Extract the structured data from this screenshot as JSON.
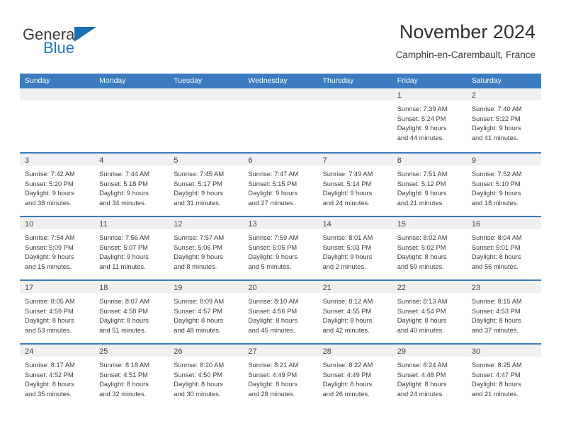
{
  "brand": {
    "name_part1": "General",
    "name_part2": "Blue",
    "flag_icon": "triangle-flag-icon",
    "accent_color": "#1b6fb5"
  },
  "header": {
    "title": "November 2024",
    "subtitle": "Camphin-en-Carembault, France"
  },
  "theme": {
    "header_blue": "#3a7cbf",
    "day_band_gray": "#f0f0f0"
  },
  "calendar": {
    "day_headers": [
      "Sunday",
      "Monday",
      "Tuesday",
      "Wednesday",
      "Thursday",
      "Friday",
      "Saturday"
    ],
    "weeks": [
      [
        {
          "day": "",
          "lines": []
        },
        {
          "day": "",
          "lines": []
        },
        {
          "day": "",
          "lines": []
        },
        {
          "day": "",
          "lines": []
        },
        {
          "day": "",
          "lines": []
        },
        {
          "day": "1",
          "lines": [
            "Sunrise: 7:39 AM",
            "Sunset: 5:24 PM",
            "Daylight: 9 hours",
            "and 44 minutes."
          ]
        },
        {
          "day": "2",
          "lines": [
            "Sunrise: 7:40 AM",
            "Sunset: 5:22 PM",
            "Daylight: 9 hours",
            "and 41 minutes."
          ]
        }
      ],
      [
        {
          "day": "3",
          "lines": [
            "Sunrise: 7:42 AM",
            "Sunset: 5:20 PM",
            "Daylight: 9 hours",
            "and 38 minutes."
          ]
        },
        {
          "day": "4",
          "lines": [
            "Sunrise: 7:44 AM",
            "Sunset: 5:18 PM",
            "Daylight: 9 hours",
            "and 34 minutes."
          ]
        },
        {
          "day": "5",
          "lines": [
            "Sunrise: 7:45 AM",
            "Sunset: 5:17 PM",
            "Daylight: 9 hours",
            "and 31 minutes."
          ]
        },
        {
          "day": "6",
          "lines": [
            "Sunrise: 7:47 AM",
            "Sunset: 5:15 PM",
            "Daylight: 9 hours",
            "and 27 minutes."
          ]
        },
        {
          "day": "7",
          "lines": [
            "Sunrise: 7:49 AM",
            "Sunset: 5:14 PM",
            "Daylight: 9 hours",
            "and 24 minutes."
          ]
        },
        {
          "day": "8",
          "lines": [
            "Sunrise: 7:51 AM",
            "Sunset: 5:12 PM",
            "Daylight: 9 hours",
            "and 21 minutes."
          ]
        },
        {
          "day": "9",
          "lines": [
            "Sunrise: 7:52 AM",
            "Sunset: 5:10 PM",
            "Daylight: 9 hours",
            "and 18 minutes."
          ]
        }
      ],
      [
        {
          "day": "10",
          "lines": [
            "Sunrise: 7:54 AM",
            "Sunset: 5:09 PM",
            "Daylight: 9 hours",
            "and 15 minutes."
          ]
        },
        {
          "day": "11",
          "lines": [
            "Sunrise: 7:56 AM",
            "Sunset: 5:07 PM",
            "Daylight: 9 hours",
            "and 11 minutes."
          ]
        },
        {
          "day": "12",
          "lines": [
            "Sunrise: 7:57 AM",
            "Sunset: 5:06 PM",
            "Daylight: 9 hours",
            "and 8 minutes."
          ]
        },
        {
          "day": "13",
          "lines": [
            "Sunrise: 7:59 AM",
            "Sunset: 5:05 PM",
            "Daylight: 9 hours",
            "and 5 minutes."
          ]
        },
        {
          "day": "14",
          "lines": [
            "Sunrise: 8:01 AM",
            "Sunset: 5:03 PM",
            "Daylight: 9 hours",
            "and 2 minutes."
          ]
        },
        {
          "day": "15",
          "lines": [
            "Sunrise: 8:02 AM",
            "Sunset: 5:02 PM",
            "Daylight: 8 hours",
            "and 59 minutes."
          ]
        },
        {
          "day": "16",
          "lines": [
            "Sunrise: 8:04 AM",
            "Sunset: 5:01 PM",
            "Daylight: 8 hours",
            "and 56 minutes."
          ]
        }
      ],
      [
        {
          "day": "17",
          "lines": [
            "Sunrise: 8:05 AM",
            "Sunset: 4:59 PM",
            "Daylight: 8 hours",
            "and 53 minutes."
          ]
        },
        {
          "day": "18",
          "lines": [
            "Sunrise: 8:07 AM",
            "Sunset: 4:58 PM",
            "Daylight: 8 hours",
            "and 51 minutes."
          ]
        },
        {
          "day": "19",
          "lines": [
            "Sunrise: 8:09 AM",
            "Sunset: 4:57 PM",
            "Daylight: 8 hours",
            "and 48 minutes."
          ]
        },
        {
          "day": "20",
          "lines": [
            "Sunrise: 8:10 AM",
            "Sunset: 4:56 PM",
            "Daylight: 8 hours",
            "and 45 minutes."
          ]
        },
        {
          "day": "21",
          "lines": [
            "Sunrise: 8:12 AM",
            "Sunset: 4:55 PM",
            "Daylight: 8 hours",
            "and 42 minutes."
          ]
        },
        {
          "day": "22",
          "lines": [
            "Sunrise: 8:13 AM",
            "Sunset: 4:54 PM",
            "Daylight: 8 hours",
            "and 40 minutes."
          ]
        },
        {
          "day": "23",
          "lines": [
            "Sunrise: 8:15 AM",
            "Sunset: 4:53 PM",
            "Daylight: 8 hours",
            "and 37 minutes."
          ]
        }
      ],
      [
        {
          "day": "24",
          "lines": [
            "Sunrise: 8:17 AM",
            "Sunset: 4:52 PM",
            "Daylight: 8 hours",
            "and 35 minutes."
          ]
        },
        {
          "day": "25",
          "lines": [
            "Sunrise: 8:18 AM",
            "Sunset: 4:51 PM",
            "Daylight: 8 hours",
            "and 32 minutes."
          ]
        },
        {
          "day": "26",
          "lines": [
            "Sunrise: 8:20 AM",
            "Sunset: 4:50 PM",
            "Daylight: 8 hours",
            "and 30 minutes."
          ]
        },
        {
          "day": "27",
          "lines": [
            "Sunrise: 8:21 AM",
            "Sunset: 4:49 PM",
            "Daylight: 8 hours",
            "and 28 minutes."
          ]
        },
        {
          "day": "28",
          "lines": [
            "Sunrise: 8:22 AM",
            "Sunset: 4:49 PM",
            "Daylight: 8 hours",
            "and 26 minutes."
          ]
        },
        {
          "day": "29",
          "lines": [
            "Sunrise: 8:24 AM",
            "Sunset: 4:48 PM",
            "Daylight: 8 hours",
            "and 24 minutes."
          ]
        },
        {
          "day": "30",
          "lines": [
            "Sunrise: 8:25 AM",
            "Sunset: 4:47 PM",
            "Daylight: 8 hours",
            "and 21 minutes."
          ]
        }
      ]
    ]
  }
}
